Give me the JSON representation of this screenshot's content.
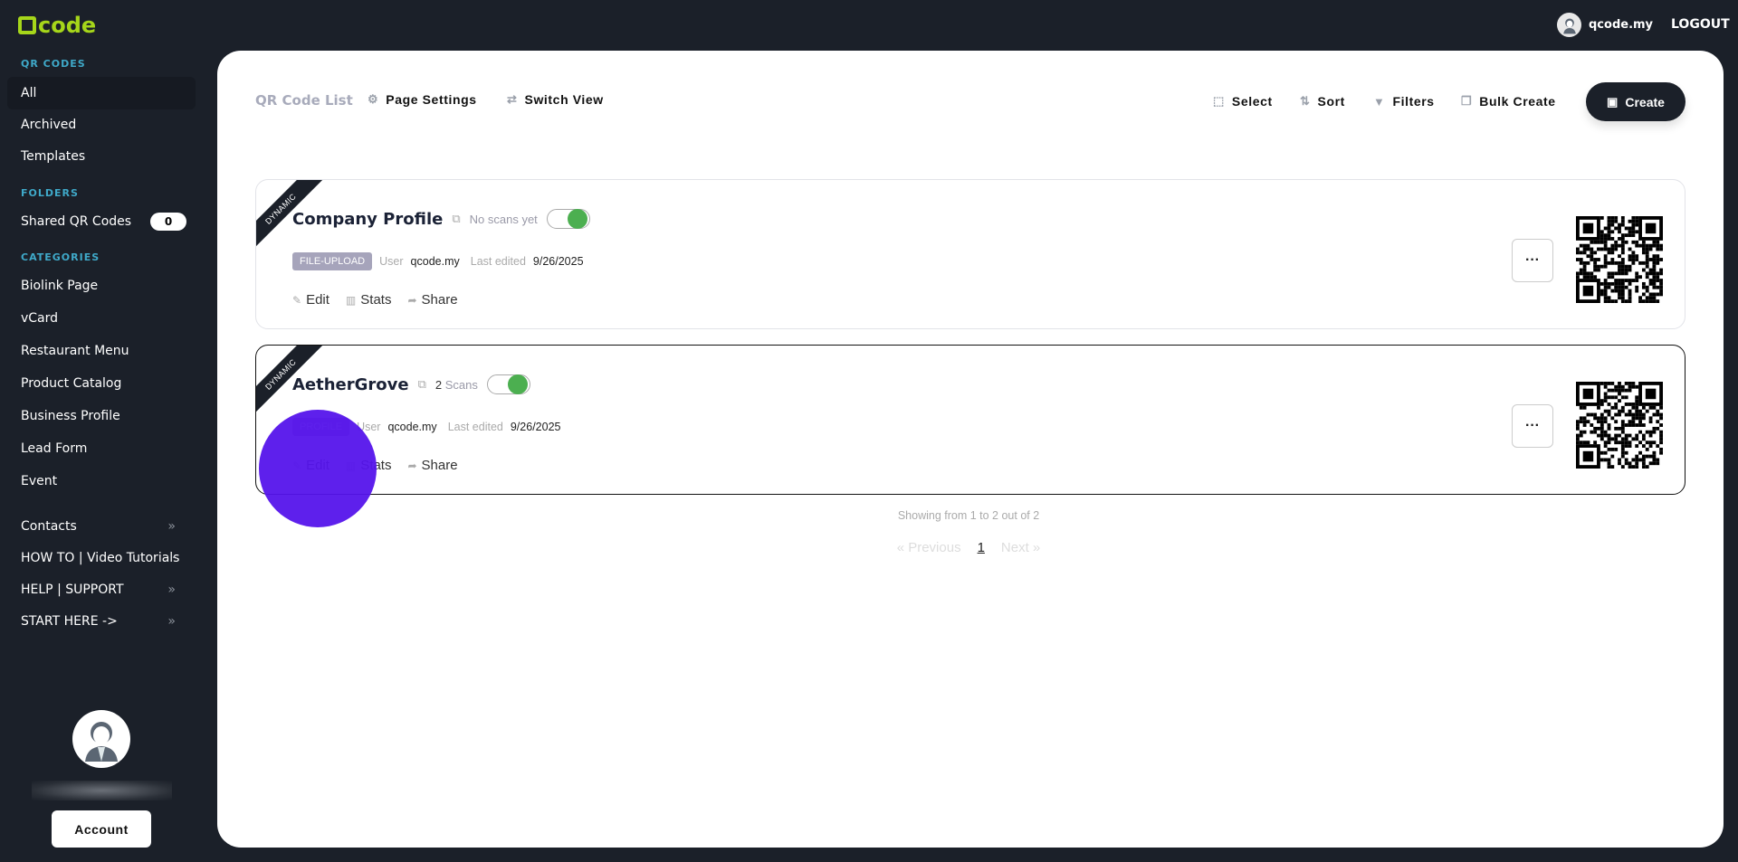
{
  "brand": {
    "logo_text": "code"
  },
  "topbar": {
    "username": "qcode.my",
    "logout": "LOGOUT"
  },
  "sidebar": {
    "sections": {
      "qr": "QR CODES",
      "folders": "FOLDERS",
      "categories": "CATEGORIES"
    },
    "qr_items": [
      "All",
      "Archived",
      "Templates"
    ],
    "folder": {
      "label": "Shared QR Codes",
      "count": "0"
    },
    "categories": [
      "Biolink Page",
      "vCard",
      "Restaurant Menu",
      "Product Catalog",
      "Business Profile",
      "Lead Form",
      "Event"
    ],
    "extra": [
      "Contacts",
      "HOW TO | Video Tutorials",
      "HELP | SUPPORT",
      "START HERE ->"
    ],
    "account": "Account"
  },
  "toolbar": {
    "title": "QR Code List",
    "page_settings": "Page Settings",
    "switch_view": "Switch View",
    "select": "Select",
    "sort": "Sort",
    "filters": "Filters",
    "bulk_create": "Bulk Create",
    "create": "Create"
  },
  "cards": [
    {
      "ribbon": "DYNAMIC",
      "name": "Company Profile",
      "scans_count": "",
      "scans_label": "No scans yet",
      "category": "FILE-UPLOAD",
      "user_label": "User",
      "user": "qcode.my",
      "edited_label": "Last edited",
      "edited": "9/26/2025",
      "enabled": true
    },
    {
      "ribbon": "DYNAMIC",
      "name": "AetherGrove",
      "scans_count": "2",
      "scans_label": "Scans",
      "category": "PROFILE",
      "user_label": "User",
      "user": "qcode.my",
      "edited_label": "Last edited",
      "edited": "9/26/2025",
      "enabled": true
    }
  ],
  "card_actions": {
    "edit": "Edit",
    "stats": "Stats",
    "share": "Share",
    "more": "···"
  },
  "pagination": {
    "showing": "Showing from 1 to 2 out of 2",
    "prev": "« Previous",
    "page": "1",
    "next": "Next »"
  }
}
